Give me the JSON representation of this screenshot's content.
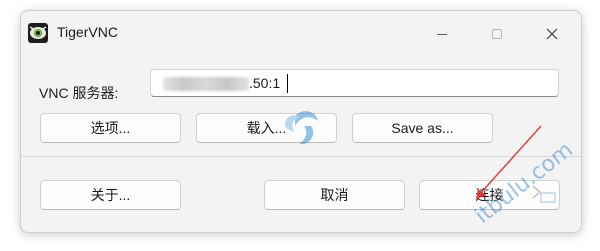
{
  "window": {
    "title": "TigerVNC",
    "controls": {
      "minimize": "minimize-icon",
      "maximize": "maximize-icon",
      "close": "close-icon"
    }
  },
  "server": {
    "label": "VNC 服务器:",
    "value_visible": ".50:1"
  },
  "buttons": {
    "options": "选项...",
    "load": "载入...",
    "save_as": "Save as...",
    "about": "关于...",
    "cancel": "取消",
    "connect": "连接"
  },
  "watermark": {
    "text": "itbulu.com"
  },
  "colors": {
    "annotation_arrow": "#e53935",
    "watermark": "#2e79c6"
  }
}
